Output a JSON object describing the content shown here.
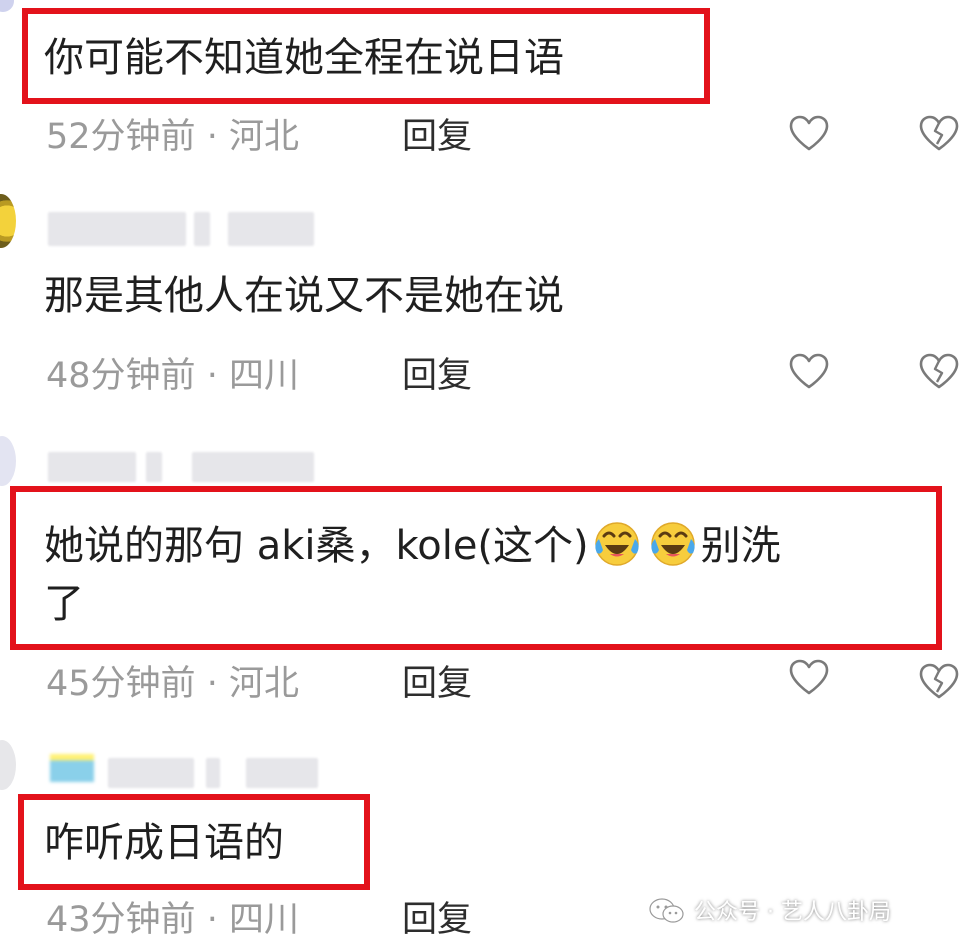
{
  "comments": [
    {
      "text": "你可能不知道她全程在说日语",
      "time": "52分钟前",
      "sep": "·",
      "location": "河北",
      "reply": "回复"
    },
    {
      "text": "那是其他人在说又不是她在说",
      "time": "48分钟前",
      "sep": "·",
      "location": "四川",
      "reply": "回复"
    },
    {
      "text_a": "她说的那句  aki桑，kole(这个)",
      "text_b": "别洗",
      "text_c": "了",
      "time": "45分钟前",
      "sep": "·",
      "location": "河北",
      "reply": "回复"
    },
    {
      "text": "咋听成日语的",
      "time": "43分钟前",
      "sep": "·",
      "location": "四川",
      "reply": "回复"
    }
  ],
  "icons": {
    "like": "heart-outline-icon",
    "dislike": "broken-heart-icon",
    "emoji": "laughing-crying-emoji",
    "wechat": "wechat-icon"
  },
  "highlight_color": "#e3121b",
  "watermark": {
    "label": "公众号 · 艺人八卦局"
  }
}
